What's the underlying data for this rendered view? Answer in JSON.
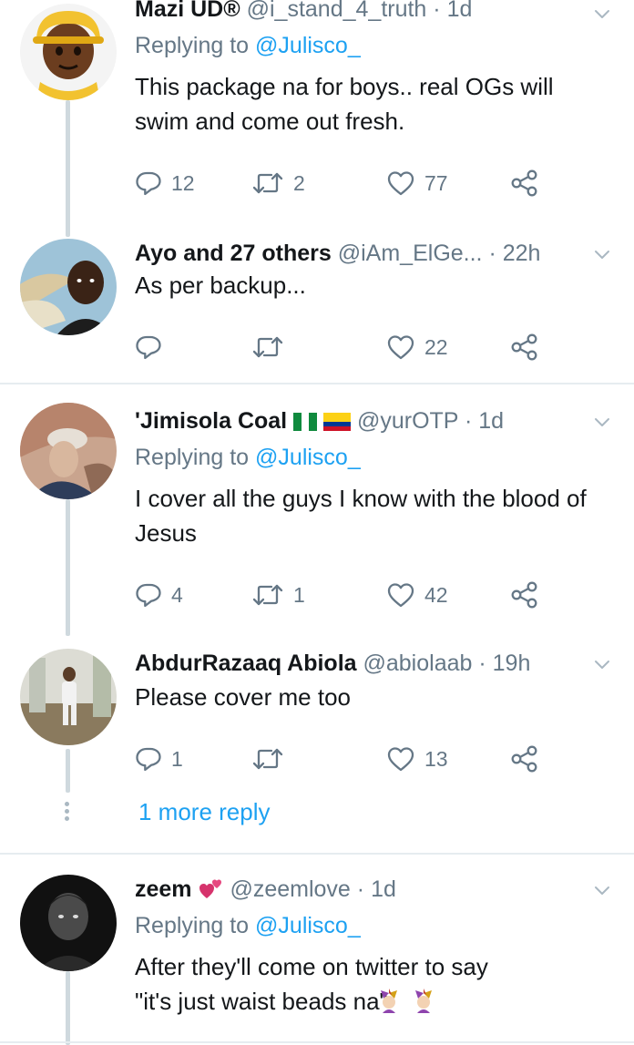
{
  "tweets": [
    {
      "name": "Mazi UD®",
      "handle": "@i_stand_4_truth",
      "time": "1d",
      "replying_prefix": "Replying to",
      "replying_to": "@Julisco_",
      "text": "This package na for boys.. real OGs will swim and come out fresh.",
      "replies": "12",
      "retweets": "2",
      "likes": "77"
    },
    {
      "name": "Ayo and 27 others",
      "handle": "@iAm_ElGe...",
      "time": "22h",
      "text": "As per backup...",
      "replies": "",
      "retweets": "",
      "likes": "22"
    },
    {
      "name": "'Jimisola Coal",
      "handle": "@yurOTP",
      "time": "1d",
      "replying_prefix": "Replying to",
      "replying_to": "@Julisco_",
      "text": "I cover all the guys I know with the blood of Jesus",
      "replies": "4",
      "retweets": "1",
      "likes": "42"
    },
    {
      "name": "AbdurRazaaq Abiola",
      "handle": "@abiolaab",
      "time": "19h",
      "text": "Please cover me too",
      "replies": "1",
      "retweets": "",
      "likes": "13"
    },
    {
      "name": "zeem",
      "handle": "@zeemlove",
      "time": "1d",
      "replying_prefix": "Replying to",
      "replying_to": "@Julisco_",
      "text": "After they'll come on twitter to say \"it's just waist beads na\""
    }
  ],
  "more_reply": "1 more reply",
  "separator": "·",
  "colors": {
    "link": "#1da1f2",
    "secondary": "#657786",
    "divider": "#e6ecf0"
  },
  "icons": [
    "reply-icon",
    "retweet-icon",
    "like-icon",
    "share-icon",
    "chevron-down-icon"
  ]
}
